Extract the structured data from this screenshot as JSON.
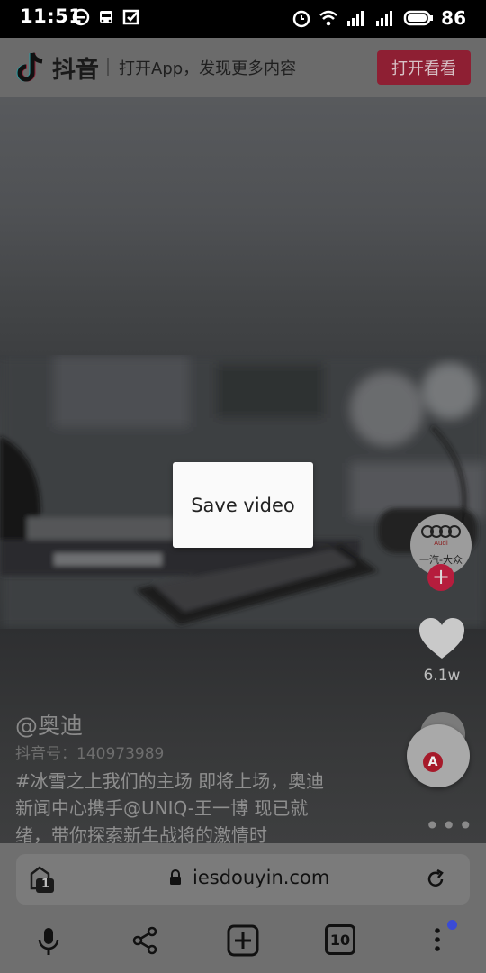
{
  "status_bar": {
    "time": "11:51",
    "battery": "86",
    "signal1": "4G",
    "signal2": "3G"
  },
  "header": {
    "logo_text": "抖音",
    "tagline": "打开App，发现更多内容",
    "open_button": "打开看看"
  },
  "dialog": {
    "save_label": "Save video"
  },
  "side": {
    "avatar_label": "一汽-大众",
    "avatar_brand": "Audi",
    "likes": "6.1w"
  },
  "caption": {
    "username": "@奥迪",
    "douyin_id": "抖音号：140973989",
    "text": "#冰雪之上我们的主场 即将上场，奥迪新闻中心携手@UNIQ-王一博 现已就绪，带你探索新生战将的激情时"
  },
  "browser": {
    "url": "iesdouyin.com",
    "tab_count": "10",
    "float_badge": "A",
    "tabs_badge": "1"
  },
  "colors": {
    "accent_red": "#b61d3d",
    "notification_dot": "#3a4bd6"
  }
}
